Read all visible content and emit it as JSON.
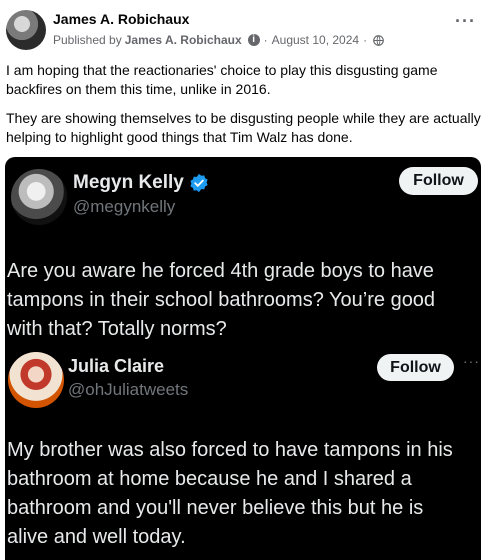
{
  "post": {
    "author": "James A. Robichaux",
    "published_by_label": "Published by",
    "publisher": "James A. Robichaux",
    "date": "August 10, 2024",
    "separator": "·",
    "audience_icon": "globe-icon",
    "more_label": "···",
    "paragraphs": [
      "I am hoping that the reactionaries' choice to play this disgusting game backfires on them this time, unlike in 2016.",
      "They are showing themselves to be disgusting people while they are actually helping to highlight good things that Tim Walz has done."
    ]
  },
  "embed": {
    "tweet1": {
      "name": "Megyn Kelly",
      "handle": "@megynkelly",
      "verified": true,
      "verified_color": "#1d9bf0",
      "follow_label": "Follow",
      "lines": [
        "Are you aware he forced 4th grade boys to have",
        "tampons in their school bathrooms? You’re good",
        "with that? Totally norms?"
      ]
    },
    "tweet2": {
      "name": "Julia Claire",
      "handle": "@ohJuliatweets",
      "follow_label": "Follow",
      "more_label": "···",
      "lines": [
        "My brother was also forced to have tampons in his",
        "bathroom at home because he and I shared a",
        "bathroom and you'll never believe this but he is",
        "alive and well today."
      ]
    }
  }
}
